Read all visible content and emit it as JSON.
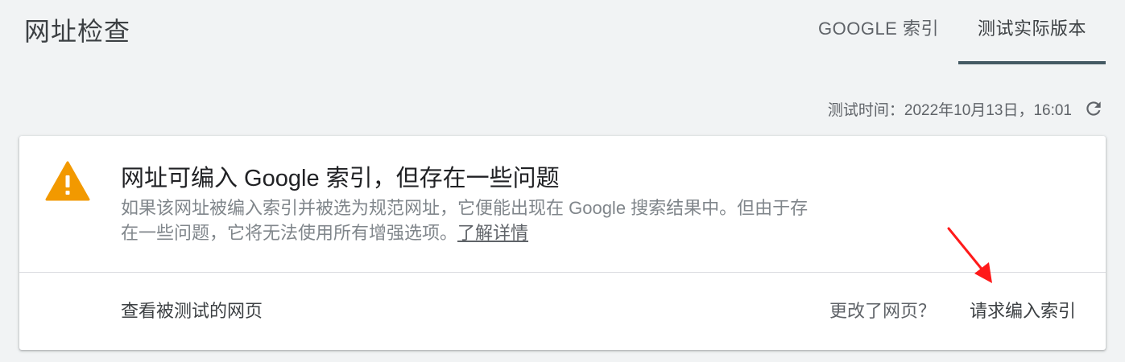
{
  "header": {
    "title": "网址检查",
    "tabs": [
      {
        "label": "GOOGLE 索引",
        "active": false
      },
      {
        "label": "测试实际版本",
        "active": true
      }
    ]
  },
  "test_time": {
    "label": "测试时间：2022年10月13日，16:01",
    "refresh_icon": "refresh-icon"
  },
  "status_card": {
    "icon": "warning-icon",
    "warning_color": "#f29900",
    "title": "网址可编入 Google 索引，但存在一些问题",
    "description": "如果该网址被编入索引并被选为规范网址，它便能出现在 Google 搜索结果中。但由于存在一些问题，它将无法使用所有增强选项。",
    "learn_more": "了解详情",
    "view_tested_page": "查看被测试的网页",
    "page_changed_question": "更改了网页？",
    "request_indexing": "请求编入索引"
  },
  "annotation": {
    "arrow_color": "#ff1a1a"
  }
}
